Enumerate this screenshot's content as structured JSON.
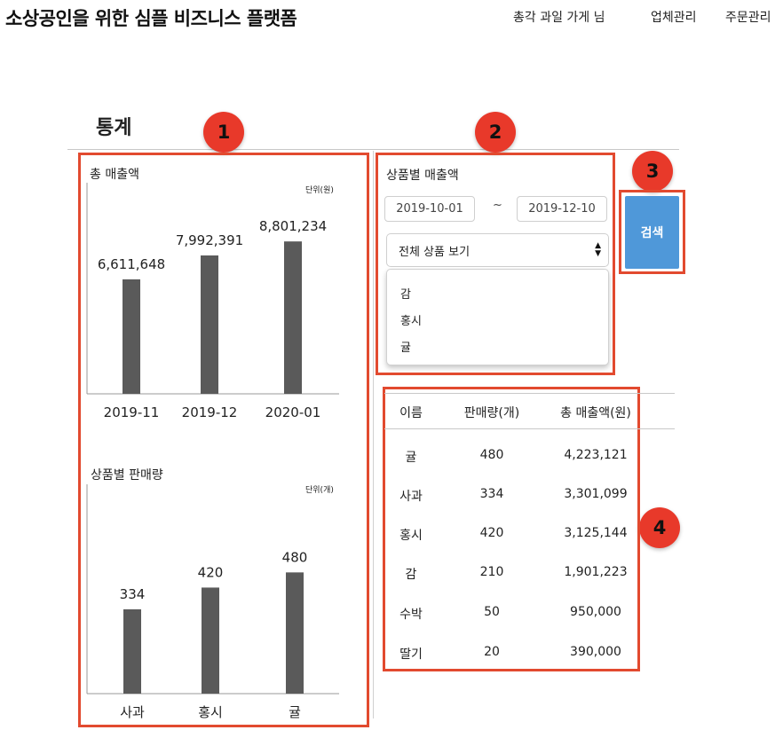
{
  "header": {
    "app_title": "소상공인을 위한 심플 비즈니스 플랫폼",
    "user_label": "총각 과일 가게 님",
    "nav": [
      "업체관리",
      "주문관리"
    ]
  },
  "page": {
    "title": "통계"
  },
  "badges": [
    "1",
    "2",
    "3",
    "4"
  ],
  "total_sales_chart": {
    "title": "총 매출액",
    "unit": "단위(원)",
    "value_labels": [
      "6,611,648",
      "7,992,391",
      "8,801,234"
    ]
  },
  "qty_chart": {
    "title": "상품별 판매량",
    "unit": "단위(개)"
  },
  "chart_data": [
    {
      "type": "bar",
      "title": "총 매출액",
      "unit": "단위(원)",
      "categories": [
        "2019-11",
        "2019-12",
        "2020-01"
      ],
      "values": [
        6611648,
        7992391,
        8801234
      ],
      "ylim": [
        0,
        12500000
      ],
      "color": "#5a5a5a"
    },
    {
      "type": "bar",
      "title": "상품별 판매량",
      "unit": "단위(개)",
      "categories": [
        "사과",
        "홍시",
        "귤"
      ],
      "values": [
        334,
        420,
        480
      ],
      "ylim": [
        0,
        850
      ],
      "color": "#5a5a5a"
    }
  ],
  "filter": {
    "title": "상품별 매출액",
    "start_date": "2019-10-01",
    "end_date": "2019-12-10",
    "tilde": "~",
    "select_value": "전체 상품 보기",
    "options": [
      "감",
      "홍시",
      "귤"
    ],
    "search_label": "검색"
  },
  "table": {
    "headers": [
      "이름",
      "판매량(개)",
      "총 매출액(원)"
    ],
    "rows": [
      [
        "귤",
        "480",
        "4,223,121"
      ],
      [
        "사과",
        "334",
        "3,301,099"
      ],
      [
        "홍시",
        "420",
        "3,125,144"
      ],
      [
        "감",
        "210",
        "1,901,223"
      ],
      [
        "수박",
        "50",
        "950,000"
      ],
      [
        "딸기",
        "20",
        "390,000"
      ]
    ]
  },
  "colors": {
    "accent_red": "#e24a2f",
    "badge_red": "#e8392a",
    "button_blue": "#4f98d9",
    "bar": "#5a5a5a"
  }
}
